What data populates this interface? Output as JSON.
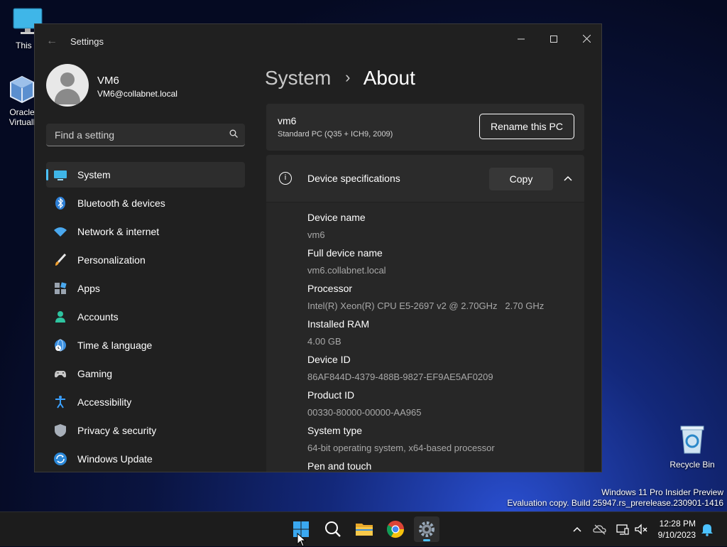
{
  "desktop": {
    "this_pc": "This P",
    "oracle_line1": "Oracle",
    "oracle_line2": "Virtuall",
    "recycle_bin": "Recycle Bin",
    "watermark_line1": "Windows 11 Pro Insider Preview",
    "watermark_line2": "Evaluation copy. Build 25947.rs_prerelease.230901-1416"
  },
  "window": {
    "title": "Settings",
    "back_icon": "back-arrow-icon",
    "controls": [
      "minimize-icon",
      "maximize-icon",
      "close-icon"
    ]
  },
  "user": {
    "name": "VM6",
    "email": "VM6@collabnet.local"
  },
  "search": {
    "placeholder": "Find a setting",
    "icon": "search-icon"
  },
  "nav": {
    "items": [
      {
        "label": "System",
        "icon": "monitor-icon",
        "selected": true
      },
      {
        "label": "Bluetooth & devices",
        "icon": "bluetooth-icon"
      },
      {
        "label": "Network & internet",
        "icon": "wifi-icon"
      },
      {
        "label": "Personalization",
        "icon": "paintbrush-icon"
      },
      {
        "label": "Apps",
        "icon": "apps-icon"
      },
      {
        "label": "Accounts",
        "icon": "person-icon"
      },
      {
        "label": "Time & language",
        "icon": "globe-clock-icon"
      },
      {
        "label": "Gaming",
        "icon": "gamepad-icon"
      },
      {
        "label": "Accessibility",
        "icon": "accessibility-icon"
      },
      {
        "label": "Privacy & security",
        "icon": "shield-icon"
      },
      {
        "label": "Windows Update",
        "icon": "update-icon"
      }
    ]
  },
  "breadcrumb": {
    "parent": "System",
    "separator": "›",
    "current": "About"
  },
  "pc_card": {
    "name": "vm6",
    "model": "Standard PC (Q35 + ICH9, 2009)",
    "rename_label": "Rename this PC"
  },
  "specs": {
    "title": "Device specifications",
    "copy_label": "Copy",
    "rows": [
      {
        "label": "Device name",
        "value": "vm6"
      },
      {
        "label": "Full device name",
        "value": "vm6.collabnet.local"
      },
      {
        "label": "Processor",
        "value": "Intel(R) Xeon(R) CPU E5-2697 v2 @ 2.70GHz   2.70 GHz"
      },
      {
        "label": "Installed RAM",
        "value": "4.00 GB"
      },
      {
        "label": "Device ID",
        "value": "86AF844D-4379-488B-9827-EF9AE5AF0209"
      },
      {
        "label": "Product ID",
        "value": "00330-80000-00000-AA965"
      },
      {
        "label": "System type",
        "value": "64-bit operating system, x64-based processor"
      },
      {
        "label": "Pen and touch",
        "value": ""
      }
    ]
  },
  "taskbar": {
    "apps": [
      "start-icon",
      "search-icon",
      "file-explorer-icon",
      "chrome-icon",
      "settings-icon"
    ],
    "tray": [
      "chevron-up-icon",
      "onedrive-icon",
      "network-icon",
      "volume-muted-icon",
      "notification-bell-icon"
    ],
    "time": "12:28 PM",
    "date": "9/10/2023"
  },
  "colors": {
    "accent": "#4cc2ff",
    "window_bg": "#202020",
    "card_bg": "#2b2b2b"
  }
}
